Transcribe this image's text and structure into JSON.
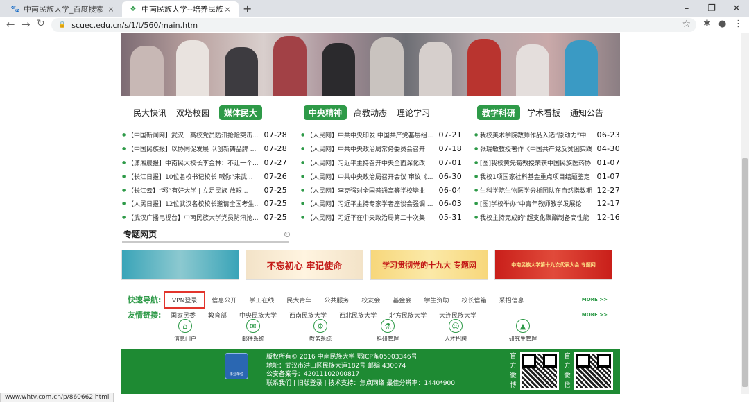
{
  "browser": {
    "tabs": [
      {
        "title": "中南民族大学_百度搜索",
        "close": "×"
      },
      {
        "title": "中南民族大学--培养民族人才的摇篮",
        "close": "×"
      }
    ],
    "new_tab": "+",
    "url": "scuec.edu.cn/s/1/t/560/main.htm",
    "status_url": "www.whtv.com.cn/p/860662.html"
  },
  "news": [
    {
      "tabs": [
        "民大快讯",
        "双塔校园",
        "媒体民大"
      ],
      "active": 2,
      "items": [
        {
          "title": "【中国新闻网】武汉一高校党员防汛抢险突击...",
          "date": "07-28"
        },
        {
          "title": "【中国民族报】以协同促发展 以创新铸品牌 ...",
          "date": "07-28"
        },
        {
          "title": "【潇湘晨报】中南民大校长李金林：不让一个...",
          "date": "07-27"
        },
        {
          "title": "【长江日报】10位名校书记校长 喊你“来武...",
          "date": "07-26"
        },
        {
          "title": "【长江云】“郛”有好大学 | 立足民族 放眼...",
          "date": "07-25"
        },
        {
          "title": "【人民日报】12位武汉名校校长邀请全国考生...",
          "date": "07-25"
        },
        {
          "title": "【武汉广播电视台】中南民族大学党员防汛抢...",
          "date": "07-25"
        }
      ]
    },
    {
      "tabs": [
        "中央精神",
        "高教动态",
        "理论学习"
      ],
      "active": 0,
      "items": [
        {
          "title": "【人民网】中共中央印发 中国共产党基层组...",
          "date": "07-21"
        },
        {
          "title": "【人民网】中共中央政治局常务委员会召开",
          "date": "07-18"
        },
        {
          "title": "【人民网】习近平主持召开中央全面深化改",
          "date": "07-01"
        },
        {
          "title": "【人民网】中共中央政治局召开会议 审议《...",
          "date": "06-30"
        },
        {
          "title": "【人民网】李克强对全国普通高等学校毕业",
          "date": "06-04"
        },
        {
          "title": "【人民网】习近平主持专家学者座谈会强调 ...",
          "date": "06-03"
        },
        {
          "title": "【人民网】习近平在中央政治局第二十次集",
          "date": "05-31"
        }
      ]
    },
    {
      "tabs": [
        "教学科研",
        "学术看板",
        "通知公告"
      ],
      "active": 0,
      "items": [
        {
          "title": "我校美术学院教师作品入选“原动力”中",
          "date": "06-23"
        },
        {
          "title": "张瑞敏教授著作《中国共产党反贫困实践",
          "date": "04-30"
        },
        {
          "title": "[图]我校黄先菊教授荣获中国民族医药协",
          "date": "01-07"
        },
        {
          "title": "我校1项国家社科基金重点项目结题鉴定",
          "date": "01-07"
        },
        {
          "title": "生科学院生物医学分析团队在自然指数期",
          "date": "12-27"
        },
        {
          "title": "[图]学校举办“中青年教师教学发展论",
          "date": "12-17"
        },
        {
          "title": "我校主持完成的“超支化聚酯制备高性能",
          "date": "12-16"
        }
      ]
    }
  ],
  "special": {
    "title": "专题网页",
    "arrow": "›"
  },
  "promos": [
    {
      "text": "",
      "bg": "#3aa4b8"
    },
    {
      "text": "不忘初心 牢记使命",
      "bg": "#f3e3c8"
    },
    {
      "text": "学习贯彻党的十九大 专题网",
      "bg": "#f7d77b"
    },
    {
      "text": "中南民族大学第十九次代表大会 专题网",
      "bg": "#c91f1a"
    }
  ],
  "quick": {
    "label": "快速导航:",
    "items": [
      "VPN登录",
      "信息公开",
      "学工在线",
      "民大青年",
      "公共服务",
      "校友会",
      "基金会",
      "学生资助",
      "校长信箱",
      "采招信息"
    ],
    "more": "MORE >>"
  },
  "friends": {
    "label": "友情链接:",
    "items": [
      "国家民委",
      "教育部",
      "中央民族大学",
      "西南民族大学",
      "西北民族大学",
      "北方民族大学",
      "大连民族大学"
    ],
    "more": "MORE >>"
  },
  "services": [
    {
      "label": "信息门户",
      "icon": "home-icon",
      "glyph": "⌂"
    },
    {
      "label": "邮件系统",
      "icon": "mail-icon",
      "glyph": "✉"
    },
    {
      "label": "教务系统",
      "icon": "gear-icon",
      "glyph": "⚙"
    },
    {
      "label": "科研管理",
      "icon": "research-icon",
      "glyph": "⚗"
    },
    {
      "label": "人才招聘",
      "icon": "person-icon",
      "glyph": "☺"
    },
    {
      "label": "研究生管理",
      "icon": "graduate-icon",
      "glyph": "▲"
    }
  ],
  "footer": {
    "lines": [
      "版权所有© 2016 中南民族大学 鄂ICP备05003346号",
      "地址：武汉市洪山区民族大道182号 邮编 430074",
      "公安备案号：42011102000817",
      "联系我们 | 旧版登录 | 技术支持：焦点网络 最佳分辨率：1440*900"
    ],
    "logo_text": "事业单位",
    "qr1_label": "官方微博",
    "qr2_label": "官方微信"
  },
  "colors": {
    "brand_green": "#2e9a48",
    "footer_green": "#1e8a33",
    "highlight_red": "#e2342c"
  }
}
